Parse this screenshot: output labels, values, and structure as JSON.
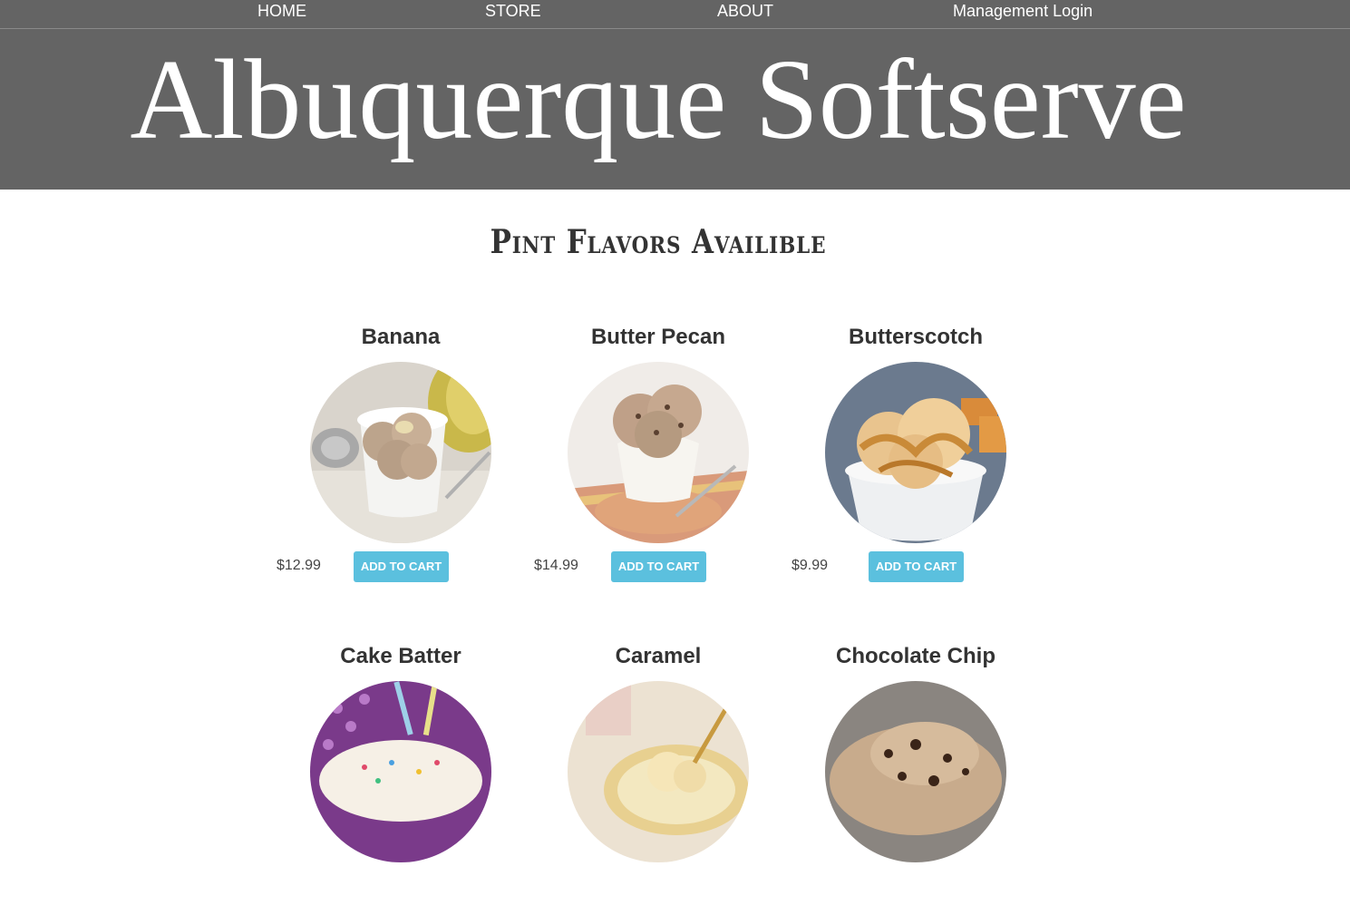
{
  "nav": {
    "items": [
      {
        "label": "HOME"
      },
      {
        "label": "STORE"
      },
      {
        "label": "ABOUT"
      },
      {
        "label": "Management Login"
      }
    ]
  },
  "banner": {
    "title": "Albuquerque Softserve"
  },
  "section": {
    "title": "Pint Flavors Availible"
  },
  "products": [
    {
      "name": "Banana",
      "price": "$12.99",
      "button": "ADD TO CART",
      "image": "banana-ice-cream-image"
    },
    {
      "name": "Butter Pecan",
      "price": "$14.99",
      "button": "ADD TO CART",
      "image": "butter-pecan-ice-cream-image"
    },
    {
      "name": "Butterscotch",
      "price": "$9.99",
      "button": "ADD TO CART",
      "image": "butterscotch-ice-cream-image"
    },
    {
      "name": "Cake Batter",
      "price": "",
      "button": "",
      "image": "cake-batter-ice-cream-image"
    },
    {
      "name": "Caramel",
      "price": "",
      "button": "",
      "image": "caramel-ice-cream-image"
    },
    {
      "name": "Chocolate Chip",
      "price": "",
      "button": "",
      "image": "chocolate-chip-ice-cream-image"
    }
  ],
  "colors": {
    "header_bg": "#646464",
    "button_bg": "#5bc0de",
    "text_dark": "#333333"
  }
}
